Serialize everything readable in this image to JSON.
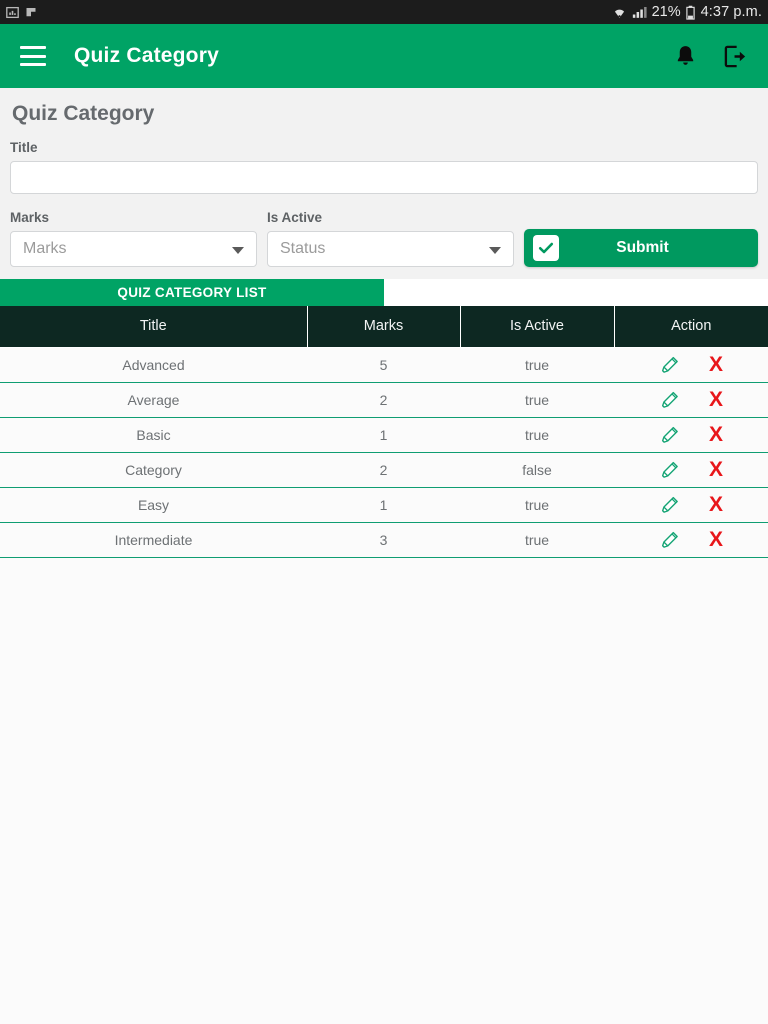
{
  "statusbar": {
    "left_icons": [
      "image-notification-icon",
      "flag-notification-icon"
    ],
    "wifi_icon": "wifi-icon",
    "signal_icon": "cell-signal-icon",
    "battery_percent": "21%",
    "battery_icon": "battery-icon",
    "time": "4:37 p.m."
  },
  "appbar": {
    "menu_icon": "hamburger-menu-icon",
    "title": "Quiz Category",
    "notification_icon": "bell-icon",
    "logout_icon": "logout-icon"
  },
  "form": {
    "heading": "Quiz Category",
    "title_label": "Title",
    "title_value": "",
    "title_placeholder": "",
    "marks_label": "Marks",
    "marks_value": "Marks",
    "is_active_label": "Is Active",
    "is_active_value": "Status",
    "submit_label": "Submit",
    "submit_check_icon": "checkbox-checked-icon"
  },
  "list": {
    "tab_label": "QUIZ CATEGORY LIST",
    "columns": [
      "Title",
      "Marks",
      "Is Active",
      "Action"
    ],
    "rows": [
      {
        "title": "Advanced",
        "marks": "5",
        "is_active": "true",
        "edit_icon": "pencil-edit-icon",
        "delete_icon": "x-delete-icon",
        "delete_label": "X"
      },
      {
        "title": "Average",
        "marks": "2",
        "is_active": "true",
        "edit_icon": "pencil-edit-icon",
        "delete_icon": "x-delete-icon",
        "delete_label": "X"
      },
      {
        "title": "Basic",
        "marks": "1",
        "is_active": "true",
        "edit_icon": "pencil-edit-icon",
        "delete_icon": "x-delete-icon",
        "delete_label": "X"
      },
      {
        "title": "Category",
        "marks": "2",
        "is_active": "false",
        "edit_icon": "pencil-edit-icon",
        "delete_icon": "x-delete-icon",
        "delete_label": "X"
      },
      {
        "title": "Easy",
        "marks": "1",
        "is_active": "true",
        "edit_icon": "pencil-edit-icon",
        "delete_icon": "x-delete-icon",
        "delete_label": "X"
      },
      {
        "title": "Intermediate",
        "marks": "3",
        "is_active": "true",
        "edit_icon": "pencil-edit-icon",
        "delete_icon": "x-delete-icon",
        "delete_label": "X"
      }
    ]
  },
  "colors": {
    "brand_green": "#00a365",
    "submit_green": "#00995f",
    "table_header": "#0d2822",
    "row_divider": "#0f9d72",
    "delete_red": "#e8161a",
    "panel_bg": "#f2f2f2",
    "statusbar_bg": "#1c1c1c"
  }
}
